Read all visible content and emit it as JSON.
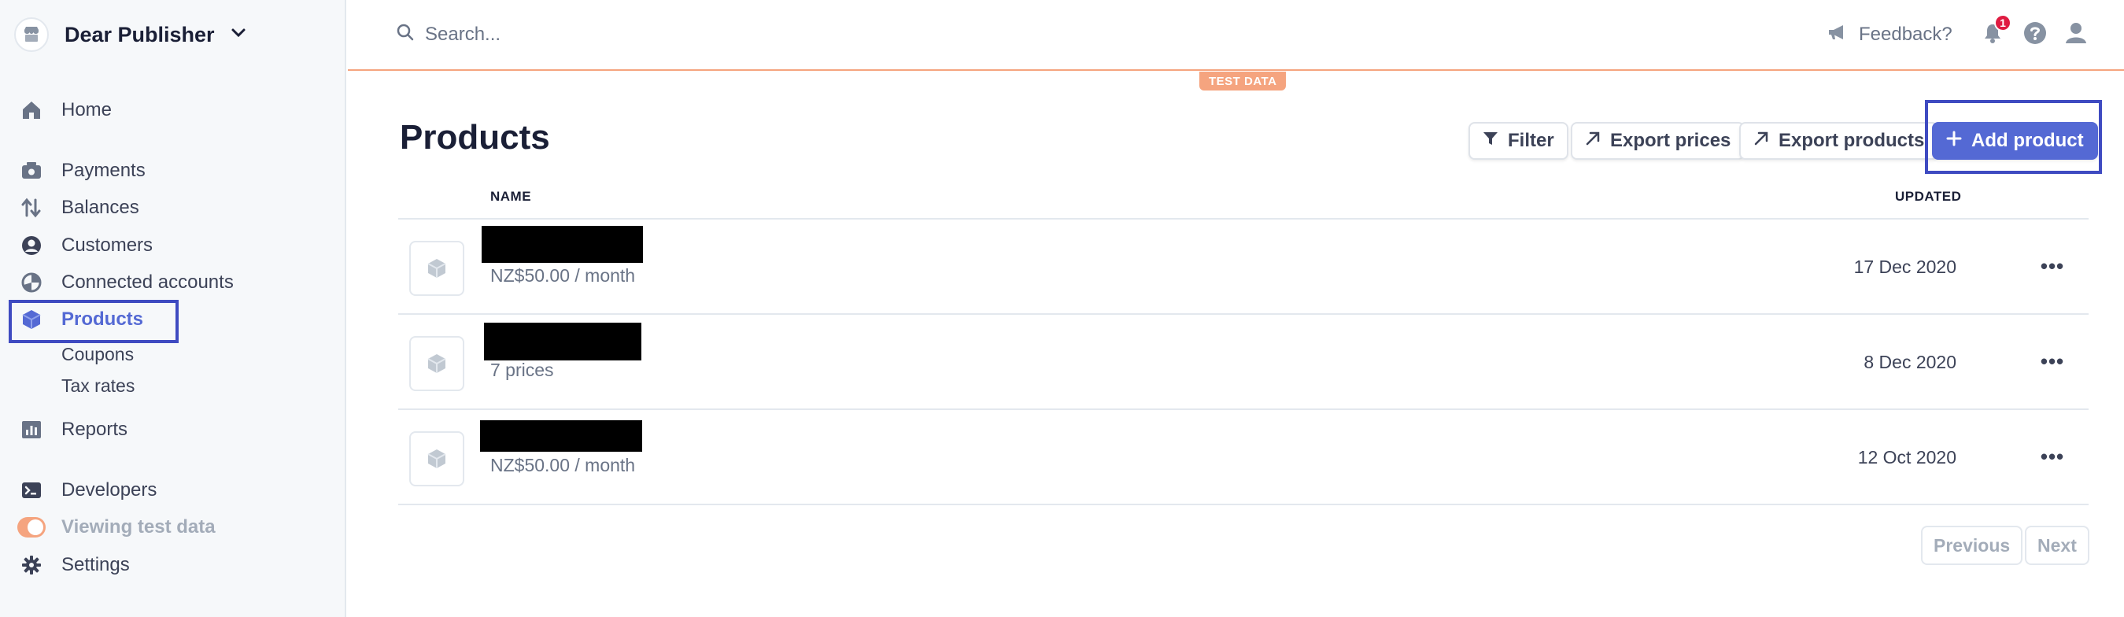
{
  "account": {
    "name": "Dear Publisher"
  },
  "sidebar": {
    "home": "Home",
    "payments": "Payments",
    "balances": "Balances",
    "customers": "Customers",
    "connected_accounts": "Connected accounts",
    "products": "Products",
    "coupons": "Coupons",
    "tax_rates": "Tax rates",
    "reports": "Reports",
    "developers": "Developers",
    "viewing_test_data": "Viewing test data",
    "settings": "Settings"
  },
  "topbar": {
    "search_placeholder": "Search...",
    "feedback": "Feedback?",
    "notification_count": "1",
    "test_data_banner": "TEST DATA"
  },
  "main": {
    "title": "Products",
    "actions": {
      "filter": "Filter",
      "export_prices": "Export prices",
      "export_products": "Export products",
      "add_product": "Add product"
    },
    "columns": {
      "name": "NAME",
      "updated": "UPDATED"
    },
    "rows": [
      {
        "subtitle": "NZ$50.00 / month",
        "updated": "17 Dec 2020"
      },
      {
        "subtitle": "7 prices",
        "updated": "8 Dec 2020"
      },
      {
        "subtitle": "NZ$50.00 / month",
        "updated": "12 Oct 2020"
      }
    ],
    "pagination": {
      "previous": "Previous",
      "next": "Next"
    }
  },
  "colors": {
    "accent": "#5469d4",
    "test_mode": "#f5a47f",
    "highlight_box": "#3f4bc1",
    "badge": "#df1b41"
  }
}
